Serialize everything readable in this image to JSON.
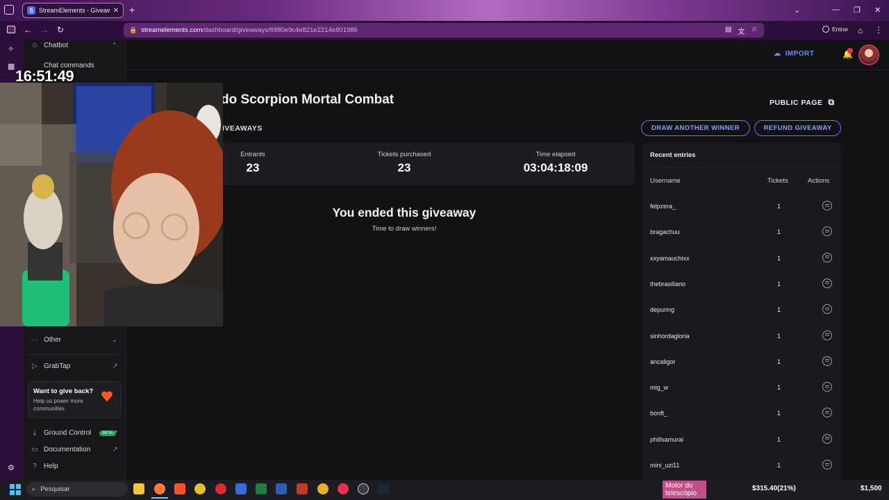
{
  "browser": {
    "tab_title": "StreamElements - Giveaway",
    "url_host": "streamelements.com",
    "url_path": "/dashboard/giveaways/6980e9c4e821e2214e801986",
    "profile_label": "Entrar"
  },
  "sidebar": {
    "chatbot_label": "Chatbot",
    "chat_commands_label": "Chat commands",
    "other_label": "Other",
    "grabtap_label": "GrabTap",
    "give_back_title": "Want to give back?",
    "give_back_text": "Help us power more communities",
    "ground_control_label": "Ground Control",
    "beta_badge": "BETA",
    "documentation_label": "Documentation",
    "help_label": "Help"
  },
  "header": {
    "import_label": "IMPORT"
  },
  "giveaway": {
    "title": "do Scorpion Mortal Combat",
    "public_page_label": "PUBLIC PAGE",
    "section_label": "IVEAWAYS",
    "draw_another_label": "DRAW ANOTHER WINNER",
    "refund_label": "REFUND GIVEAWAY",
    "stats": [
      {
        "label": "Entrants",
        "value": "23"
      },
      {
        "label": "Tickets purchased",
        "value": "23"
      },
      {
        "label": "Time elapsed",
        "value": "03:04:18:09"
      }
    ],
    "ended_title": "You ended this giveaway",
    "ended_subtitle": "Time to draw winners!"
  },
  "entries": {
    "title": "Recent entries",
    "columns": {
      "username": "Username",
      "tickets": "Tickets",
      "actions": "Actions"
    },
    "rows": [
      {
        "username": "felpzera_",
        "tickets": "1"
      },
      {
        "username": "bragachuu",
        "tickets": "1"
      },
      {
        "username": "xxyamauchixx",
        "tickets": "1"
      },
      {
        "username": "thebrasiliano",
        "tickets": "1"
      },
      {
        "username": "depuring",
        "tickets": "1"
      },
      {
        "username": "sinhordagloria",
        "tickets": "1"
      },
      {
        "username": "ancaligor",
        "tickets": "1"
      },
      {
        "username": "mig_w",
        "tickets": "1"
      },
      {
        "username": "bonft_",
        "tickets": "1"
      },
      {
        "username": "phillsamurai",
        "tickets": "1"
      },
      {
        "username": "mini_uzi11",
        "tickets": "1"
      }
    ]
  },
  "overlay": {
    "clock": "16:51:49"
  },
  "taskbar": {
    "search_placeholder": "Pesquisar",
    "widget_label": "Motor do telescópio",
    "stock_value": "$315.40(21%)",
    "price_value": "$1,500"
  },
  "colors": {
    "accent": "#5f7cf7",
    "brand_purple": "#6a2b7e"
  }
}
